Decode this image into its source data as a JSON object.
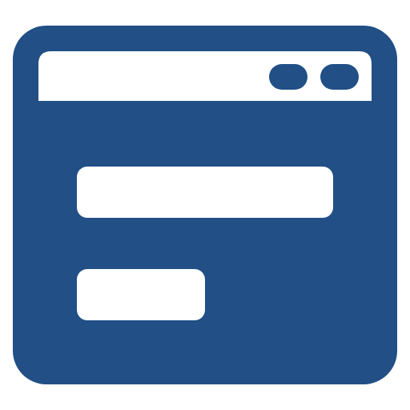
{
  "icon": {
    "name": "browser-window-form-icon",
    "colors": {
      "frame": "#214f86",
      "fill": "#ffffff",
      "background": "#ffffff"
    },
    "elements": [
      "window-frame",
      "title-bar",
      "window-control-pill",
      "window-control-pill",
      "text-field",
      "button"
    ]
  }
}
